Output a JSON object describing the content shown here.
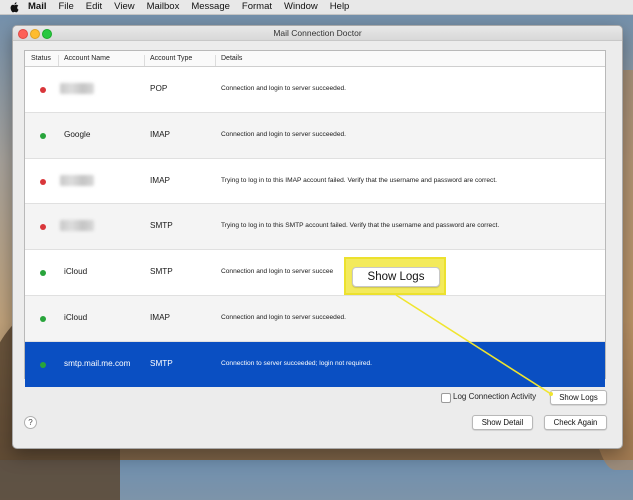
{
  "menubar": {
    "items": [
      {
        "label": "Mail",
        "bold": true
      },
      {
        "label": "File"
      },
      {
        "label": "Edit"
      },
      {
        "label": "View"
      },
      {
        "label": "Mailbox"
      },
      {
        "label": "Message"
      },
      {
        "label": "Format"
      },
      {
        "label": "Window"
      },
      {
        "label": "Help"
      }
    ]
  },
  "window": {
    "title": "Mail Connection Doctor"
  },
  "table": {
    "headers": {
      "status": "Status",
      "account_name": "Account Name",
      "account_type": "Account Type",
      "details": "Details"
    },
    "rows": [
      {
        "status": "red",
        "name": "",
        "name_obscured": true,
        "type": "POP",
        "details": "Connection and login to server succeeded."
      },
      {
        "status": "green",
        "name": "Google",
        "name_obscured": false,
        "type": "IMAP",
        "details": "Connection and login to server succeeded."
      },
      {
        "status": "red",
        "name": "",
        "name_obscured": true,
        "type": "IMAP",
        "details": "Trying to log in to this IMAP account failed. Verify that the username and password are correct."
      },
      {
        "status": "red",
        "name": "",
        "name_obscured": true,
        "type": "SMTP",
        "details": "Trying to log in to this SMTP account failed. Verify that the username and password are correct."
      },
      {
        "status": "green",
        "name": "iCloud",
        "name_obscured": false,
        "type": "SMTP",
        "details": "Connection and login to server succee"
      },
      {
        "status": "green",
        "name": "iCloud",
        "name_obscured": false,
        "type": "IMAP",
        "details": "Connection and login to server succeeded."
      },
      {
        "status": "green",
        "name": "smtp.mail.me.com",
        "name_obscured": false,
        "type": "SMTP",
        "details": "Connection to server succeeded; login not required.",
        "selected": true
      }
    ]
  },
  "controls": {
    "log_activity_label": "Log Connection Activity",
    "log_activity_checked": false,
    "show_logs": "Show Logs",
    "show_detail": "Show Detail",
    "check_again": "Check Again",
    "help": "?"
  },
  "callout": {
    "label": "Show Logs"
  },
  "colors": {
    "status_green": "#28a43b",
    "status_red": "#d9363a",
    "selection_blue": "#0a4fc2",
    "callout_yellow": "#f3ea5c"
  }
}
